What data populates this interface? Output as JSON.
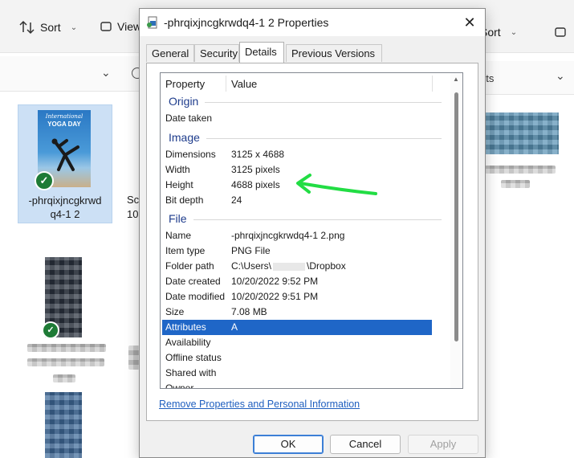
{
  "explorer_left": {
    "sort_label": "Sort",
    "view_label": "View",
    "selected_file": {
      "name_line1": "-phrqixjncgkrwd",
      "name_line2": "q4-1 2",
      "thumb_title1": "International",
      "thumb_title2": "YOGA DAY"
    },
    "partial_file": {
      "line1": "Sc",
      "line2": "10"
    }
  },
  "explorer_right": {
    "sort_label": "Sort",
    "address_partial": "ots"
  },
  "dialog": {
    "title": "-phrqixjncgkrwdq4-1 2 Properties",
    "tabs": [
      "General",
      "Security",
      "Details",
      "Previous Versions"
    ],
    "active_tab": "Details",
    "columns": {
      "property": "Property",
      "value": "Value"
    },
    "groups": {
      "origin": "Origin",
      "image": "Image",
      "file": "File"
    },
    "origin_rows": [
      {
        "key": "Date taken",
        "value": ""
      }
    ],
    "image_rows": [
      {
        "key": "Dimensions",
        "value": "3125 x 4688"
      },
      {
        "key": "Width",
        "value": "3125 pixels"
      },
      {
        "key": "Height",
        "value": "4688 pixels"
      },
      {
        "key": "Bit depth",
        "value": "24"
      }
    ],
    "file_rows": [
      {
        "key": "Name",
        "value": "-phrqixjncgkrwdq4-1 2.png"
      },
      {
        "key": "Item type",
        "value": "PNG File"
      },
      {
        "key": "Folder path",
        "value_prefix": "C:\\Users\\",
        "value_suffix": "\\Dropbox"
      },
      {
        "key": "Date created",
        "value": "10/20/2022 9:52 PM"
      },
      {
        "key": "Date modified",
        "value": "10/20/2022 9:51 PM"
      },
      {
        "key": "Size",
        "value": "7.08 MB"
      },
      {
        "key": "Attributes",
        "value": "A"
      },
      {
        "key": "Availability",
        "value": ""
      },
      {
        "key": "Offline status",
        "value": ""
      },
      {
        "key": "Shared with",
        "value": ""
      },
      {
        "key": "Owner",
        "value": ""
      }
    ],
    "remove_link": "Remove Properties and Personal Information",
    "buttons": {
      "ok": "OK",
      "cancel": "Cancel",
      "apply": "Apply"
    }
  },
  "colors": {
    "selection": "#1f66c7",
    "group_label": "#1e3c8c",
    "link": "#1f5fbf",
    "annotation_arrow": "#22dd44"
  }
}
